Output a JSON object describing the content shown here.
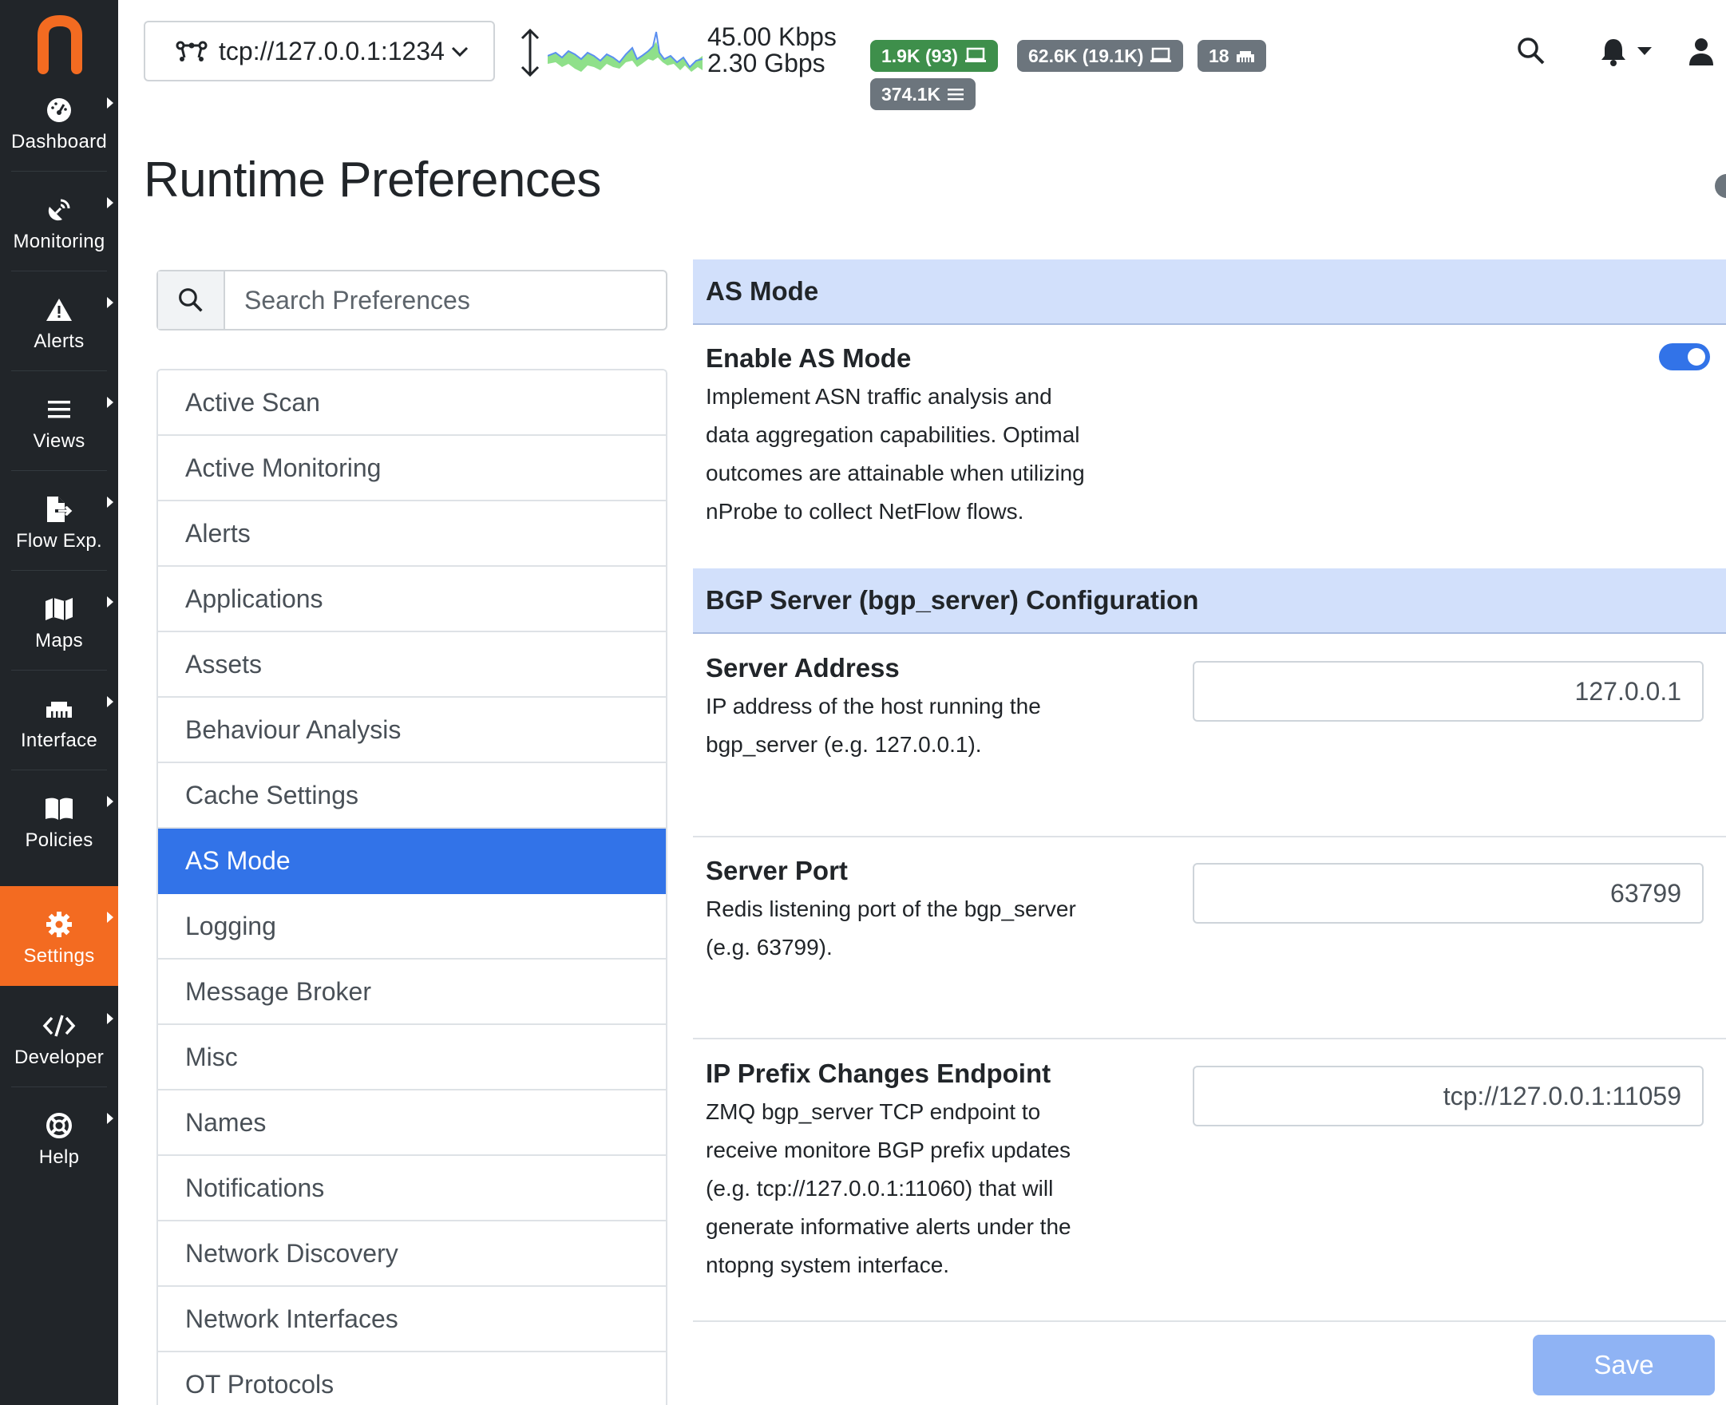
{
  "sidebar": {
    "logo": "n",
    "items": [
      {
        "label": "Dashboard",
        "icon": "gauge-icon"
      },
      {
        "label": "Monitoring",
        "icon": "satellite-dish-icon"
      },
      {
        "label": "Alerts",
        "icon": "warning-triangle-icon"
      },
      {
        "label": "Views",
        "icon": "bars-icon"
      },
      {
        "label": "Flow Exp.",
        "icon": "file-export-icon"
      },
      {
        "label": "Maps",
        "icon": "map-icon"
      },
      {
        "label": "Interface",
        "icon": "ethernet-icon"
      },
      {
        "label": "Policies",
        "icon": "book-icon"
      },
      {
        "label": "Settings",
        "icon": "cog-icon",
        "active": true
      },
      {
        "label": "Developer",
        "icon": "code-icon"
      },
      {
        "label": "Help",
        "icon": "life-ring-icon"
      }
    ]
  },
  "topbar": {
    "interface": "tcp://127.0.0.1:1234",
    "throughput_up": "45.00 Kbps",
    "throughput_down": "2.30 Gbps",
    "badges": [
      {
        "text": "1.9K (93)",
        "icon": "laptop-icon",
        "color": "#3e8f4b"
      },
      {
        "text": "62.6K (19.1K)",
        "icon": "laptop-icon",
        "color": "#6c757d"
      },
      {
        "text": "18",
        "icon": "ethernet-icon",
        "color": "#6c757d"
      },
      {
        "text": "374.1K",
        "icon": "bars-icon",
        "color": "#6c757d"
      }
    ]
  },
  "page": {
    "title": "Runtime Preferences"
  },
  "search": {
    "placeholder": "Search Preferences"
  },
  "categories": [
    "Active Scan",
    "Active Monitoring",
    "Alerts",
    "Applications",
    "Assets",
    "Behaviour Analysis",
    "Cache Settings",
    "AS Mode",
    "Logging",
    "Message Broker",
    "Misc",
    "Names",
    "Notifications",
    "Network Discovery",
    "Network Interfaces",
    "OT Protocols"
  ],
  "active_category": "AS Mode",
  "sections": {
    "as_mode": {
      "title": "AS Mode",
      "enable": {
        "title": "Enable AS Mode",
        "lines": [
          "Implement ASN traffic analysis and",
          "data aggregation capabilities. Optimal",
          "outcomes are attainable when utilizing",
          "nProbe to collect NetFlow flows."
        ],
        "enabled": true
      }
    },
    "bgp": {
      "title": "BGP Server (bgp_server) Configuration",
      "server_address": {
        "title": "Server Address",
        "lines": [
          "IP address of the host running the",
          "bgp_server (e.g. 127.0.0.1)."
        ],
        "value": "127.0.0.1"
      },
      "server_port": {
        "title": "Server Port",
        "lines": [
          "Redis listening port of the bgp_server",
          "(e.g. 63799)."
        ],
        "value": "63799"
      },
      "prefix_endpoint": {
        "title": "IP Prefix Changes Endpoint",
        "lines": [
          "ZMQ bgp_server TCP endpoint to",
          "receive monitore BGP prefix updates",
          "(e.g. tcp://127.0.0.1:11060) that will",
          "generate informative alerts under the",
          "ntopng system interface."
        ],
        "value": "tcp://127.0.0.1:11059"
      }
    }
  },
  "save_label": "Save",
  "colors": {
    "sidebar": "#212529",
    "accent_orange": "#f36b21",
    "primary_blue": "#3273e8",
    "section_header": "#d2e0fb"
  }
}
